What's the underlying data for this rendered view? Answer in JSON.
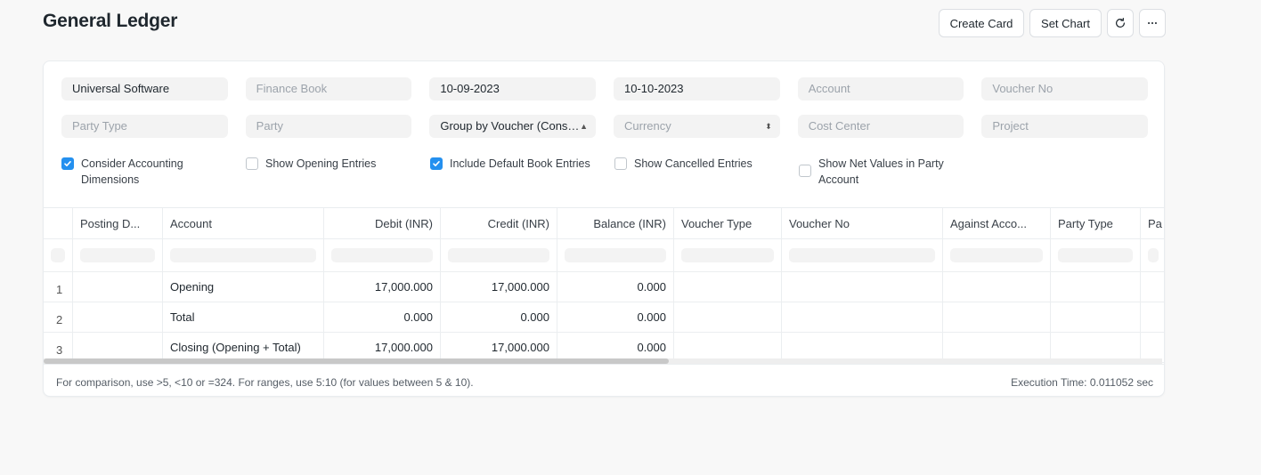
{
  "page": {
    "title": "General Ledger"
  },
  "actions": {
    "create_card": "Create Card",
    "set_chart": "Set Chart"
  },
  "filters": {
    "row1": [
      {
        "value": "Universal Software",
        "placeholder": false
      },
      {
        "value": "Finance Book",
        "placeholder": true
      },
      {
        "value": "10-09-2023",
        "placeholder": false
      },
      {
        "value": "10-10-2023",
        "placeholder": false
      },
      {
        "value": "Account",
        "placeholder": true
      },
      {
        "value": "Voucher No",
        "placeholder": true
      }
    ],
    "row2": [
      {
        "value": "Party Type",
        "placeholder": true
      },
      {
        "value": "Party",
        "placeholder": true
      },
      {
        "value": "Group by Voucher (Cons…",
        "placeholder": false
      },
      {
        "value": "Currency",
        "placeholder": true
      },
      {
        "value": "Cost Center",
        "placeholder": true
      },
      {
        "value": "Project",
        "placeholder": true
      }
    ]
  },
  "checks": [
    {
      "label": "Consider Accounting Dimensions",
      "checked": true
    },
    {
      "label": "Show Opening Entries",
      "checked": false
    },
    {
      "label": "Include Default Book Entries",
      "checked": true
    },
    {
      "label": "Show Cancelled Entries",
      "checked": false
    },
    {
      "label": "Show Net Values in Party Account",
      "checked": false
    }
  ],
  "table": {
    "columns": [
      "Posting D...",
      "Account",
      "Debit (INR)",
      "Credit (INR)",
      "Balance (INR)",
      "Voucher Type",
      "Voucher No",
      "Against Acco...",
      "Party Type",
      "Pa"
    ],
    "rows": [
      {
        "num": "1",
        "account": "Opening",
        "debit": "17,000.000",
        "credit": "17,000.000",
        "balance": "0.000"
      },
      {
        "num": "2",
        "account": "Total",
        "debit": "0.000",
        "credit": "0.000",
        "balance": "0.000"
      },
      {
        "num": "3",
        "account": "Closing (Opening + Total)",
        "debit": "17,000.000",
        "credit": "17,000.000",
        "balance": "0.000"
      }
    ]
  },
  "footer": {
    "hint": "For comparison, use >5, <10 or =324. For ranges, use 5:10 (for values between 5 & 10).",
    "execution": "Execution Time: 0.011052 sec"
  },
  "colors": {
    "accent": "#2490ef",
    "field_bg": "#f3f3f3"
  }
}
